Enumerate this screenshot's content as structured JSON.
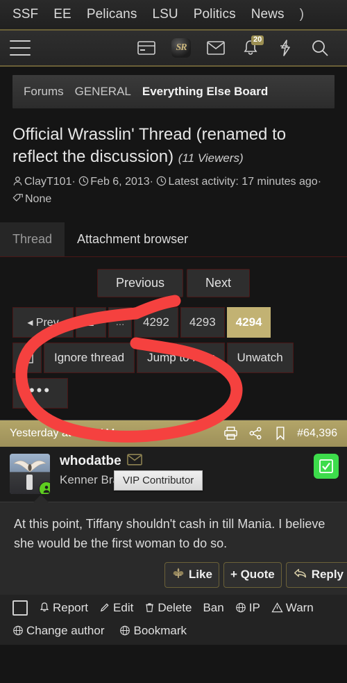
{
  "topnav": {
    "items": [
      {
        "label": "SSF"
      },
      {
        "label": "EE"
      },
      {
        "label": "Pelicans"
      },
      {
        "label": "LSU"
      },
      {
        "label": "Politics"
      },
      {
        "label": "News"
      },
      {
        "label": ")"
      }
    ]
  },
  "iconbar": {
    "menu": "hamburger-menu",
    "card": "credit-card-icon",
    "logo_text": "SR",
    "mail": "envelope-icon",
    "alerts": "bell-icon",
    "alerts_count": "20",
    "bolt": "lightning-icon",
    "search": "search-icon"
  },
  "breadcrumb": {
    "forums": "Forums",
    "category": "GENERAL",
    "current": "Everything Else Board"
  },
  "thread": {
    "title": "Official Wrasslin' Thread (renamed to reflect the discussion)",
    "viewers": "(11 Viewers)",
    "author": "ClayT101",
    "sep1": "·",
    "date": "Feb 6, 2013",
    "sep2": "·",
    "activity": "Latest activity: 17 minutes ago",
    "sep3": "·",
    "tags": "None"
  },
  "tabs": [
    {
      "label": "Thread",
      "active": true
    },
    {
      "label": "Attachment browser",
      "active": false
    }
  ],
  "pager": {
    "previous": "Previous",
    "next": "Next",
    "pages": [
      {
        "label": "◂ Prev",
        "type": "prev"
      },
      {
        "label": "1",
        "type": "num"
      },
      {
        "label": "...",
        "type": "dots"
      },
      {
        "label": "4292",
        "type": "num"
      },
      {
        "label": "4293",
        "type": "num"
      },
      {
        "label": "4294",
        "type": "active"
      }
    ]
  },
  "thread_actions": {
    "checkbox": "☑",
    "ignore": "Ignore thread",
    "jump": "Jump to new",
    "unwatch": "Unwatch",
    "more": "•••"
  },
  "post": {
    "date": "Yesterday at 9:15 AM",
    "print_icon": "printer-icon",
    "share_icon": "share-icon",
    "bookmark_icon": "bookmark-icon",
    "number": "#64,396",
    "username": "whodatbe",
    "user_title": "Kenner Brah!",
    "vip_badge": "VIP Contributor",
    "message": "At this point, Tiffany shouldn't cash in till Mania. I believe she would be the first woman to do so.",
    "like": "Like",
    "quote": "+ Quote",
    "reply": "Reply"
  },
  "moderation": {
    "row1": [
      {
        "label": "Report",
        "icon": "bell-icon"
      },
      {
        "label": "Edit",
        "icon": "pencil-icon"
      },
      {
        "label": "Delete",
        "icon": "trash-icon"
      },
      {
        "label": "Ban",
        "icon": "none"
      },
      {
        "label": "IP",
        "icon": "globe-icon"
      },
      {
        "label": "Warn",
        "icon": "warning-icon"
      }
    ],
    "row2": [
      {
        "label": "Change author",
        "icon": "globe-icon"
      },
      {
        "label": "Bookmark",
        "icon": "globe-icon"
      }
    ]
  },
  "colors": {
    "accent_gold": "#b3a568",
    "page_active": "#c2b273",
    "annotation_red": "#f5413f",
    "online_green": "#5ecd20",
    "check_green": "#3ddc4b"
  }
}
